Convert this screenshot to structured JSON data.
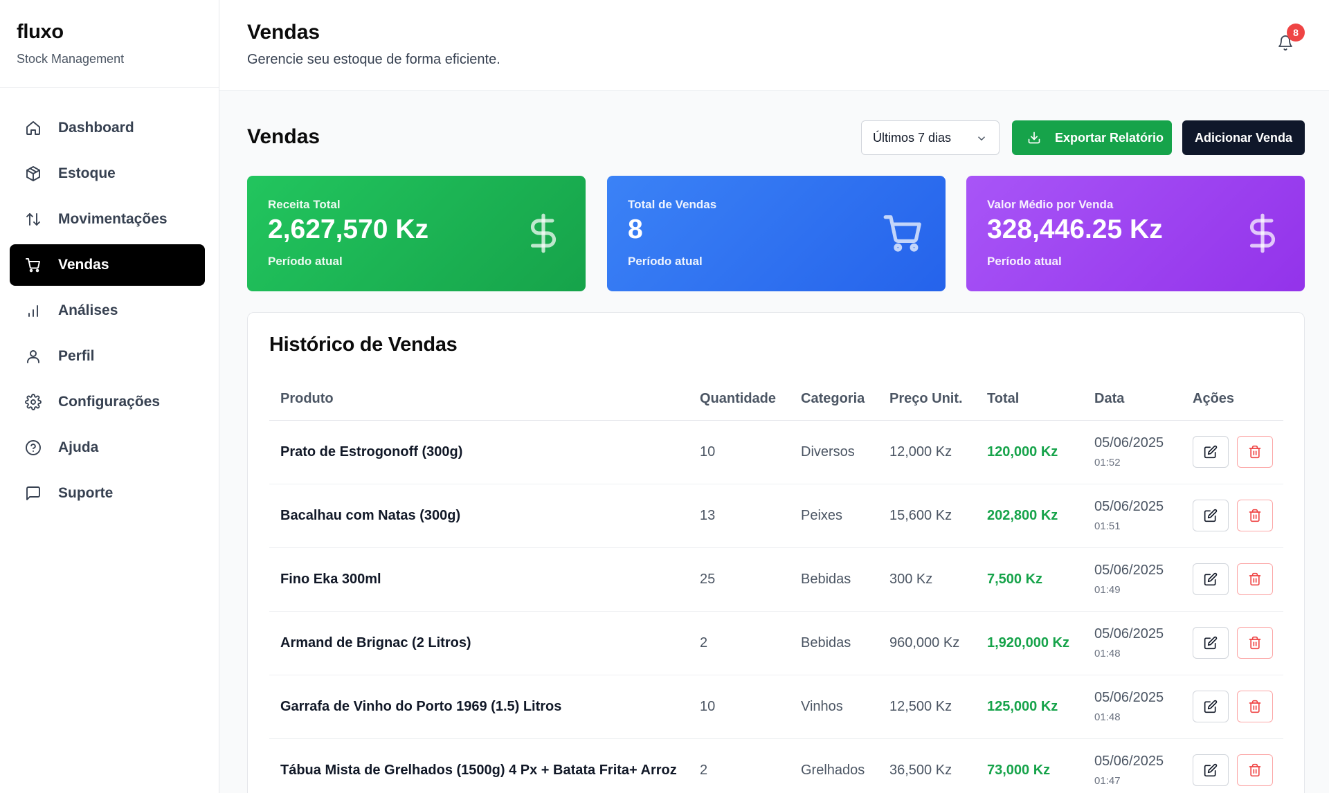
{
  "sidebar": {
    "brand": "fluxo",
    "subtitle": "Stock Management",
    "items": [
      {
        "label": "Dashboard",
        "icon": "home-icon"
      },
      {
        "label": "Estoque",
        "icon": "box-icon"
      },
      {
        "label": "Movimentações",
        "icon": "arrows-up-down-icon"
      },
      {
        "label": "Vendas",
        "icon": "cart-icon",
        "active": true
      },
      {
        "label": "Análises",
        "icon": "bar-chart-icon"
      },
      {
        "label": "Perfil",
        "icon": "user-icon"
      },
      {
        "label": "Configurações",
        "icon": "gear-icon"
      },
      {
        "label": "Ajuda",
        "icon": "help-circle-icon"
      },
      {
        "label": "Suporte",
        "icon": "message-icon"
      }
    ]
  },
  "header": {
    "title": "Vendas",
    "subtitle": "Gerencie seu estoque de forma eficiente.",
    "notification_count": "8"
  },
  "main": {
    "title": "Vendas",
    "period_select": "Últimos 7 dias",
    "export_label": "Exportar Relatório",
    "add_label": "Adicionar Venda"
  },
  "cards": [
    {
      "label": "Receita Total",
      "value": "2,627,570 Kz",
      "foot": "Período atual",
      "icon": "dollar-icon",
      "color": "#22c55e"
    },
    {
      "label": "Total de Vendas",
      "value": "8",
      "foot": "Período atual",
      "icon": "cart-icon",
      "color": "#3b82f6"
    },
    {
      "label": "Valor Médio por Venda",
      "value": "328,446.25 Kz",
      "foot": "Período atual",
      "icon": "dollar-icon",
      "color": "#a855f7"
    }
  ],
  "history": {
    "title": "Histórico de Vendas",
    "columns": [
      "Produto",
      "Quantidade",
      "Categoria",
      "Preço Unit.",
      "Total",
      "Data",
      "Ações"
    ],
    "rows": [
      {
        "produto": "Prato de Estrogonoff (300g)",
        "quantidade": "10",
        "categoria": "Diversos",
        "preco": "12,000 Kz",
        "total": "120,000 Kz",
        "data": "05/06/2025",
        "hora": "01:52"
      },
      {
        "produto": "Bacalhau com Natas (300g)",
        "quantidade": "13",
        "categoria": "Peixes",
        "preco": "15,600 Kz",
        "total": "202,800 Kz",
        "data": "05/06/2025",
        "hora": "01:51"
      },
      {
        "produto": "Fino Eka 300ml",
        "quantidade": "25",
        "categoria": "Bebidas",
        "preco": "300 Kz",
        "total": "7,500 Kz",
        "data": "05/06/2025",
        "hora": "01:49"
      },
      {
        "produto": "Armand de Brignac (2 Litros)",
        "quantidade": "2",
        "categoria": "Bebidas",
        "preco": "960,000 Kz",
        "total": "1,920,000 Kz",
        "data": "05/06/2025",
        "hora": "01:48"
      },
      {
        "produto": "Garrafa de Vinho do Porto 1969 (1.5) Litros",
        "quantidade": "10",
        "categoria": "Vinhos",
        "preco": "12,500 Kz",
        "total": "125,000 Kz",
        "data": "05/06/2025",
        "hora": "01:48"
      },
      {
        "produto": "Tábua Mista de Grelhados (1500g) 4 Px + Batata Frita+ Arroz",
        "quantidade": "2",
        "categoria": "Grelhados",
        "preco": "36,500 Kz",
        "total": "73,000 Kz",
        "data": "05/06/2025",
        "hora": "01:47"
      }
    ]
  }
}
